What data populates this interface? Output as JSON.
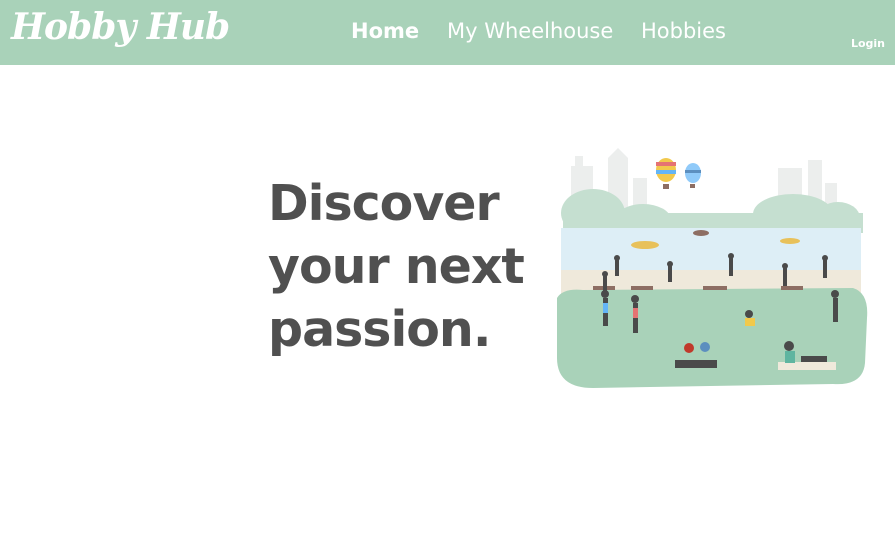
{
  "navbar": {
    "brand": "Hobby Hub",
    "links": [
      {
        "label": "Home",
        "active": true
      },
      {
        "label": "My Wheelhouse",
        "active": false
      },
      {
        "label": "Hobbies",
        "active": false
      }
    ],
    "login_label": "Login",
    "background_color": "#a9d2b9"
  },
  "hero": {
    "lines": [
      "Discover",
      "your next",
      "passion."
    ],
    "text_color": "#505050"
  },
  "illustration": {
    "icon": "park-scene-illustration"
  }
}
